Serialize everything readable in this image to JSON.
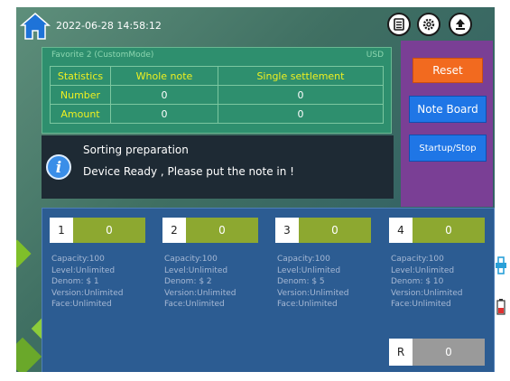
{
  "header": {
    "datetime": "2022-06-28 14:58:12",
    "icons": [
      "home-icon",
      "document-icon",
      "gear-icon",
      "upload-icon"
    ]
  },
  "stats": {
    "mode": "Favorite 2 (CustomMode)",
    "currency": "USD",
    "columns": [
      "Statistics",
      "Whole note",
      "Single settlement"
    ],
    "rows": [
      {
        "label": "Number",
        "whole": "0",
        "single": "0"
      },
      {
        "label": "Amount",
        "whole": "0",
        "single": "0"
      }
    ]
  },
  "side": {
    "reset": "Reset",
    "note_board": "Note Board",
    "startup_stop": "Startup/Stop"
  },
  "message": {
    "title": "Sorting preparation",
    "text": "Device Ready , Please put the note in !",
    "icon": "info-icon"
  },
  "pockets": [
    {
      "num": "1",
      "count": "0",
      "capacity": "Capacity:100",
      "level": "Level:Unlimited",
      "denom": "Denom: $ 1",
      "version": "Version:Unlimited",
      "face": "Face:Unlimited"
    },
    {
      "num": "2",
      "count": "0",
      "capacity": "Capacity:100",
      "level": "Level:Unlimited",
      "denom": "Denom: $ 2",
      "version": "Version:Unlimited",
      "face": "Face:Unlimited"
    },
    {
      "num": "3",
      "count": "0",
      "capacity": "Capacity:100",
      "level": "Level:Unlimited",
      "denom": "Denom: $ 5",
      "version": "Version:Unlimited",
      "face": "Face:Unlimited"
    },
    {
      "num": "4",
      "count": "0",
      "capacity": "Capacity:100",
      "level": "Level:Unlimited",
      "denom": "Denom: $ 10",
      "version": "Version:Unlimited",
      "face": "Face:Unlimited"
    }
  ],
  "reject": {
    "label": "R",
    "count": "0"
  },
  "colors": {
    "stats_bg": "#2e8f6e",
    "side_bg": "#7a3f95",
    "reset": "#f26a1f",
    "blue_button": "#1f76e6",
    "pocket_count": "#8da830",
    "reject_count": "#9a9a9a"
  }
}
